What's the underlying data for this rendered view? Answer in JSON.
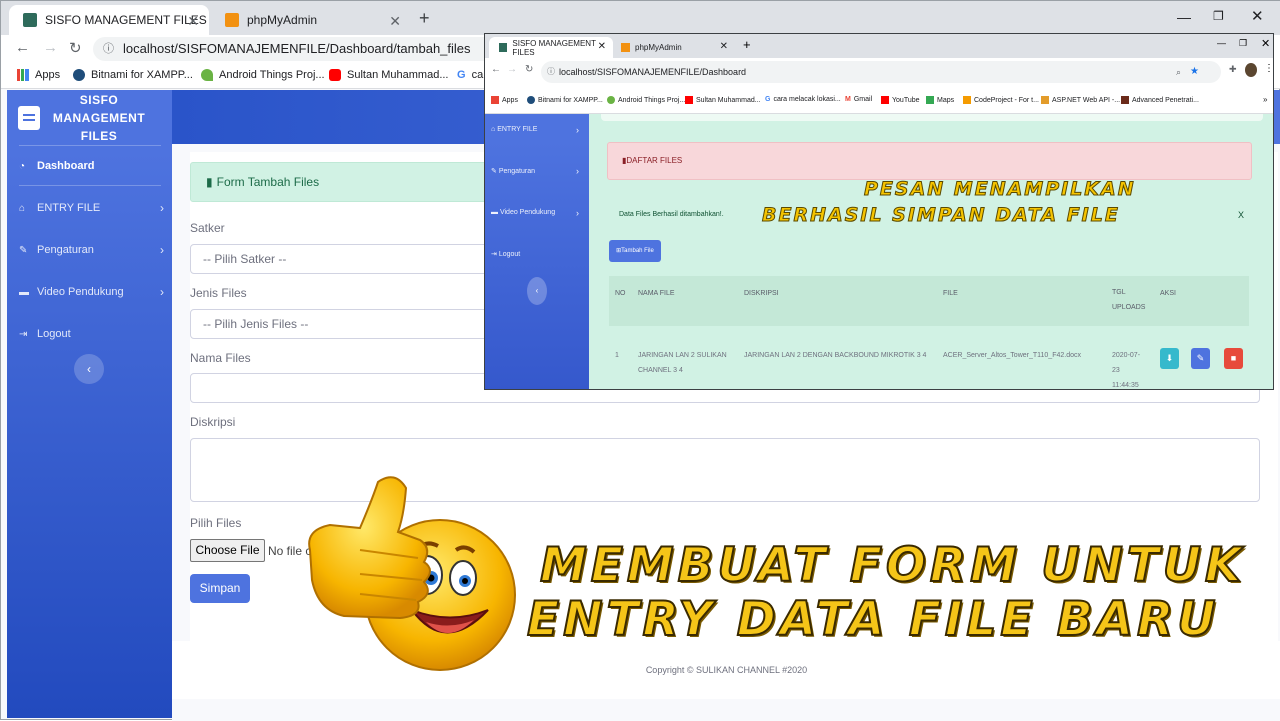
{
  "main_browser": {
    "tabs": [
      {
        "title": "SISFO MANAGEMENT FILES",
        "active": true
      },
      {
        "title": "phpMyAdmin",
        "active": false
      }
    ],
    "url": "localhost/SISFOMANAJEMENFILE/Dashboard/tambah_files",
    "bookmarks": [
      "Apps",
      "Bitnami for XAMPP...",
      "Android Things Proj...",
      "Sultan Muhammad...",
      "ca"
    ]
  },
  "sidebar": {
    "brand_line1": "SISFO",
    "brand_line2": "MANAGEMENT",
    "brand_line3": "FILES",
    "items": [
      {
        "label": "Dashboard"
      },
      {
        "label": "ENTRY FILE"
      },
      {
        "label": "Pengaturan"
      },
      {
        "label": "Video Pendukung"
      },
      {
        "label": "Logout"
      }
    ]
  },
  "form": {
    "header": "Form Tambah Files",
    "satker_label": "Satker",
    "satker_value": "-- Pilih Satker --",
    "jenis_label": "Jenis Files",
    "jenis_value": "-- Pilih Jenis Files --",
    "nama_label": "Nama Files",
    "diskripsi_label": "Diskripsi",
    "pilih_label": "Pilih Files",
    "choose_btn": "Choose File",
    "no_file": "No file ch",
    "submit": "Simpan"
  },
  "footer": {
    "copyright": "Copyright © SULIKAN CHANNEL #2020"
  },
  "overlay_browser": {
    "tabs": [
      {
        "title": "SISFO MANAGEMENT FILES",
        "active": true
      },
      {
        "title": "phpMyAdmin",
        "active": false
      }
    ],
    "url": "localhost/SISFOMANAJEMENFILE/Dashboard",
    "bookmarks": [
      "Apps",
      "Bitnami for XAMPP...",
      "Android Things Proj...",
      "Sultan Muhammad...",
      "cara melacak lokasi...",
      "Gmail",
      "YouTube",
      "Maps",
      "CodeProject - For t...",
      "ASP.NET Web API -...",
      "Advanced Penetrati..."
    ],
    "sidebar_items": [
      "ENTRY FILE",
      "Pengaturan",
      "Video Pendukung",
      "Logout"
    ],
    "panel_title": "DAFTAR FILES",
    "success_msg": "Data Files Berhasil ditambahkan!.",
    "close_x": "X",
    "add_button": "Tambah File",
    "table_headers": [
      "NO",
      "NAMA FILE",
      "DISKRIPSI",
      "FILE",
      "TGL UPLOADS",
      "AKSI"
    ],
    "row": {
      "no": "1",
      "nama": "JARINGAN LAN 2 SULIKAN CHANNEL 3 4",
      "diskripsi": "JARINGAN LAN 2 DENGAN BACKBOUND MIKROTIK 3 4",
      "file": "ACER_Server_Altos_Tower_T110_F42.docx",
      "tgl": "2020-07-23 11:44:35"
    }
  },
  "captions": {
    "pesan_line1": "PESAN MENAMPILKAN",
    "pesan_line2": "BERHASIL SIMPAN DATA FILE",
    "title_line1": "MEMBUAT FORM UNTUK",
    "title_line2": "ENTRY DATA FILE BARU"
  },
  "colors": {
    "primary": "#4e73df",
    "success_bg": "#d1f2e4",
    "danger_bg": "#f8d7da",
    "caption": "#f5c400"
  }
}
